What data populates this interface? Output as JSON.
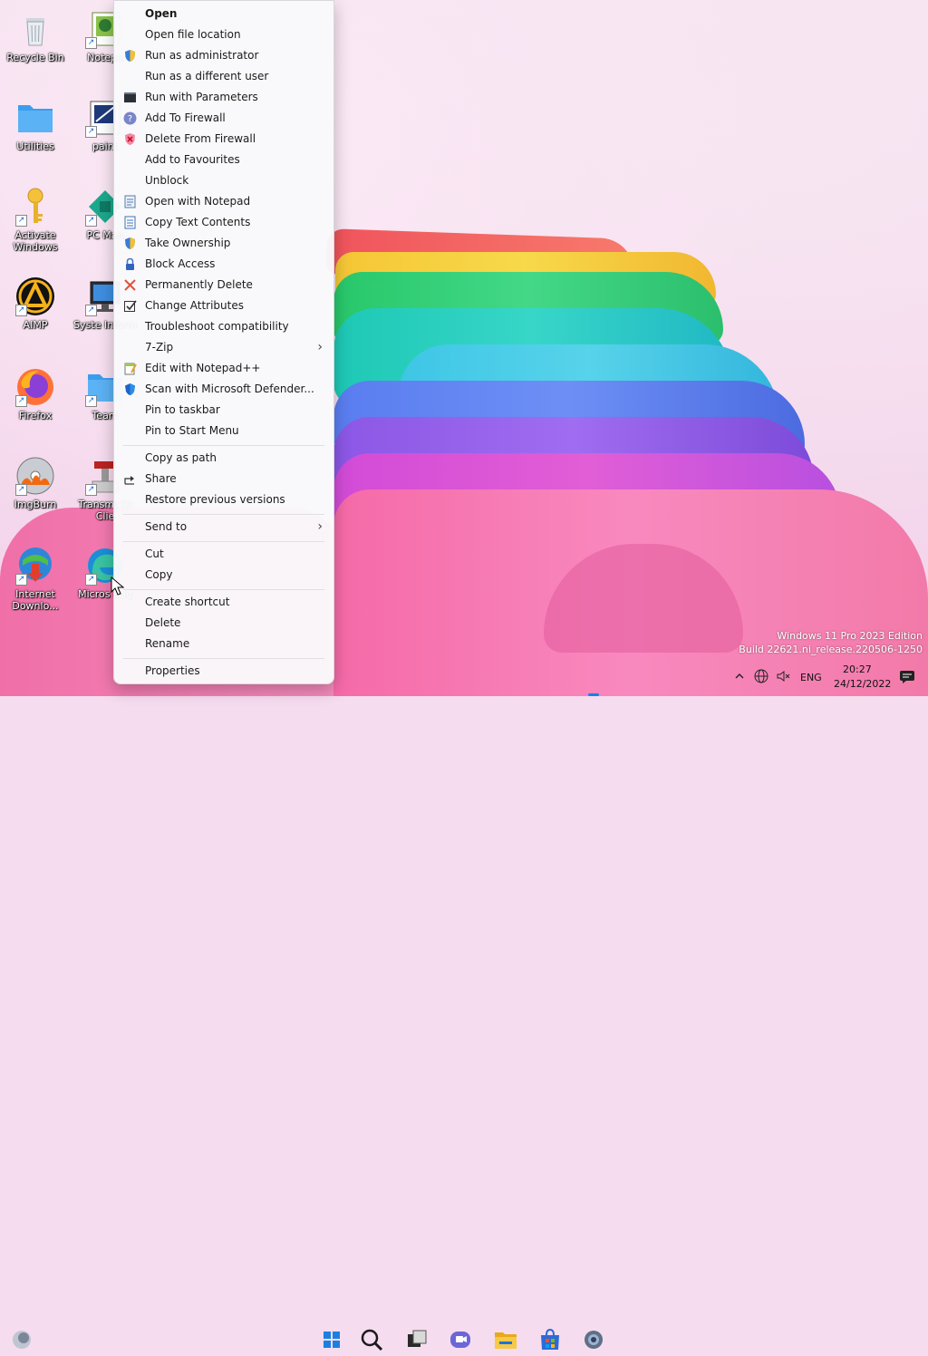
{
  "desktop_icons": [
    {
      "label": "Recycle Bin",
      "icon": "recycle-bin-icon"
    },
    {
      "label": "Notepa",
      "icon": "notepad-icon"
    },
    {
      "label": "Utilities",
      "icon": "folder-icon"
    },
    {
      "label": "paint",
      "icon": "paint-icon"
    },
    {
      "label": "Activate Windows",
      "icon": "key-icon"
    },
    {
      "label": "PC Man",
      "icon": "pc-manager-icon"
    },
    {
      "label": "AIMP",
      "icon": "aimp-icon"
    },
    {
      "label": "Syste Inform",
      "icon": "system-info-icon"
    },
    {
      "label": "Firefox",
      "icon": "firefox-icon"
    },
    {
      "label": "Team",
      "icon": "folder-icon"
    },
    {
      "label": "ImgBurn",
      "icon": "imgburn-icon"
    },
    {
      "label": "Transmi Qt Clie",
      "icon": "transmission-icon"
    },
    {
      "label": "Internet Downlo...",
      "icon": "idm-icon"
    },
    {
      "label": "Micros Edg",
      "icon": "edge-icon"
    }
  ],
  "context_menu": {
    "items": [
      {
        "label": "Open",
        "icon": "",
        "bold": true
      },
      {
        "label": "Open file location",
        "icon": ""
      },
      {
        "label": "Run as administrator",
        "icon": "shield-icon"
      },
      {
        "label": "Run as a different user",
        "icon": ""
      },
      {
        "label": "Run with Parameters",
        "icon": "terminal-icon"
      },
      {
        "label": "Add To Firewall",
        "icon": "question-icon"
      },
      {
        "label": "Delete From Firewall",
        "icon": "shield-x-icon"
      },
      {
        "label": "Add to Favourites",
        "icon": ""
      },
      {
        "label": "Unblock",
        "icon": ""
      },
      {
        "label": "Open with Notepad",
        "icon": "notepad-icon"
      },
      {
        "label": "Copy Text Contents",
        "icon": "copy-text-icon"
      },
      {
        "label": "Take Ownership",
        "icon": "shield-icon"
      },
      {
        "label": "Block Access",
        "icon": "lock-icon"
      },
      {
        "label": "Permanently Delete",
        "icon": "x-icon"
      },
      {
        "label": "Change Attributes",
        "icon": "checkbox-icon"
      },
      {
        "label": "Troubleshoot compatibility",
        "icon": ""
      },
      {
        "label": "7-Zip",
        "icon": "",
        "submenu": true
      },
      {
        "label": "Edit with Notepad++",
        "icon": "notepadpp-icon"
      },
      {
        "label": "Scan with Microsoft Defender...",
        "icon": "defender-icon"
      },
      {
        "label": "Pin to taskbar",
        "icon": ""
      },
      {
        "label": "Pin to Start Menu",
        "icon": ""
      },
      {
        "label": "Copy as path",
        "icon": ""
      },
      {
        "label": "Share",
        "icon": "share-icon"
      },
      {
        "label": "Restore previous versions",
        "icon": ""
      },
      {
        "label": "Send to",
        "icon": "",
        "submenu": true
      },
      {
        "label": "Cut",
        "icon": ""
      },
      {
        "label": "Copy",
        "icon": ""
      },
      {
        "label": "Create shortcut",
        "icon": ""
      },
      {
        "label": "Delete",
        "icon": ""
      },
      {
        "label": "Rename",
        "icon": ""
      },
      {
        "label": "Properties",
        "icon": ""
      }
    ],
    "chevron": "›"
  },
  "watermark": {
    "line1": "Windows 11 Pro 2023 Edition",
    "line2": "Build 22621.ni_release.220506-1250"
  },
  "taskbar": {
    "apps": [
      "start-icon",
      "search-icon",
      "task-view-icon",
      "teams-chat-icon",
      "file-explorer-icon",
      "store-icon",
      "settings-icon"
    ],
    "tray": {
      "language": "ENG",
      "time": "20:27",
      "date": "24/12/2022"
    }
  }
}
